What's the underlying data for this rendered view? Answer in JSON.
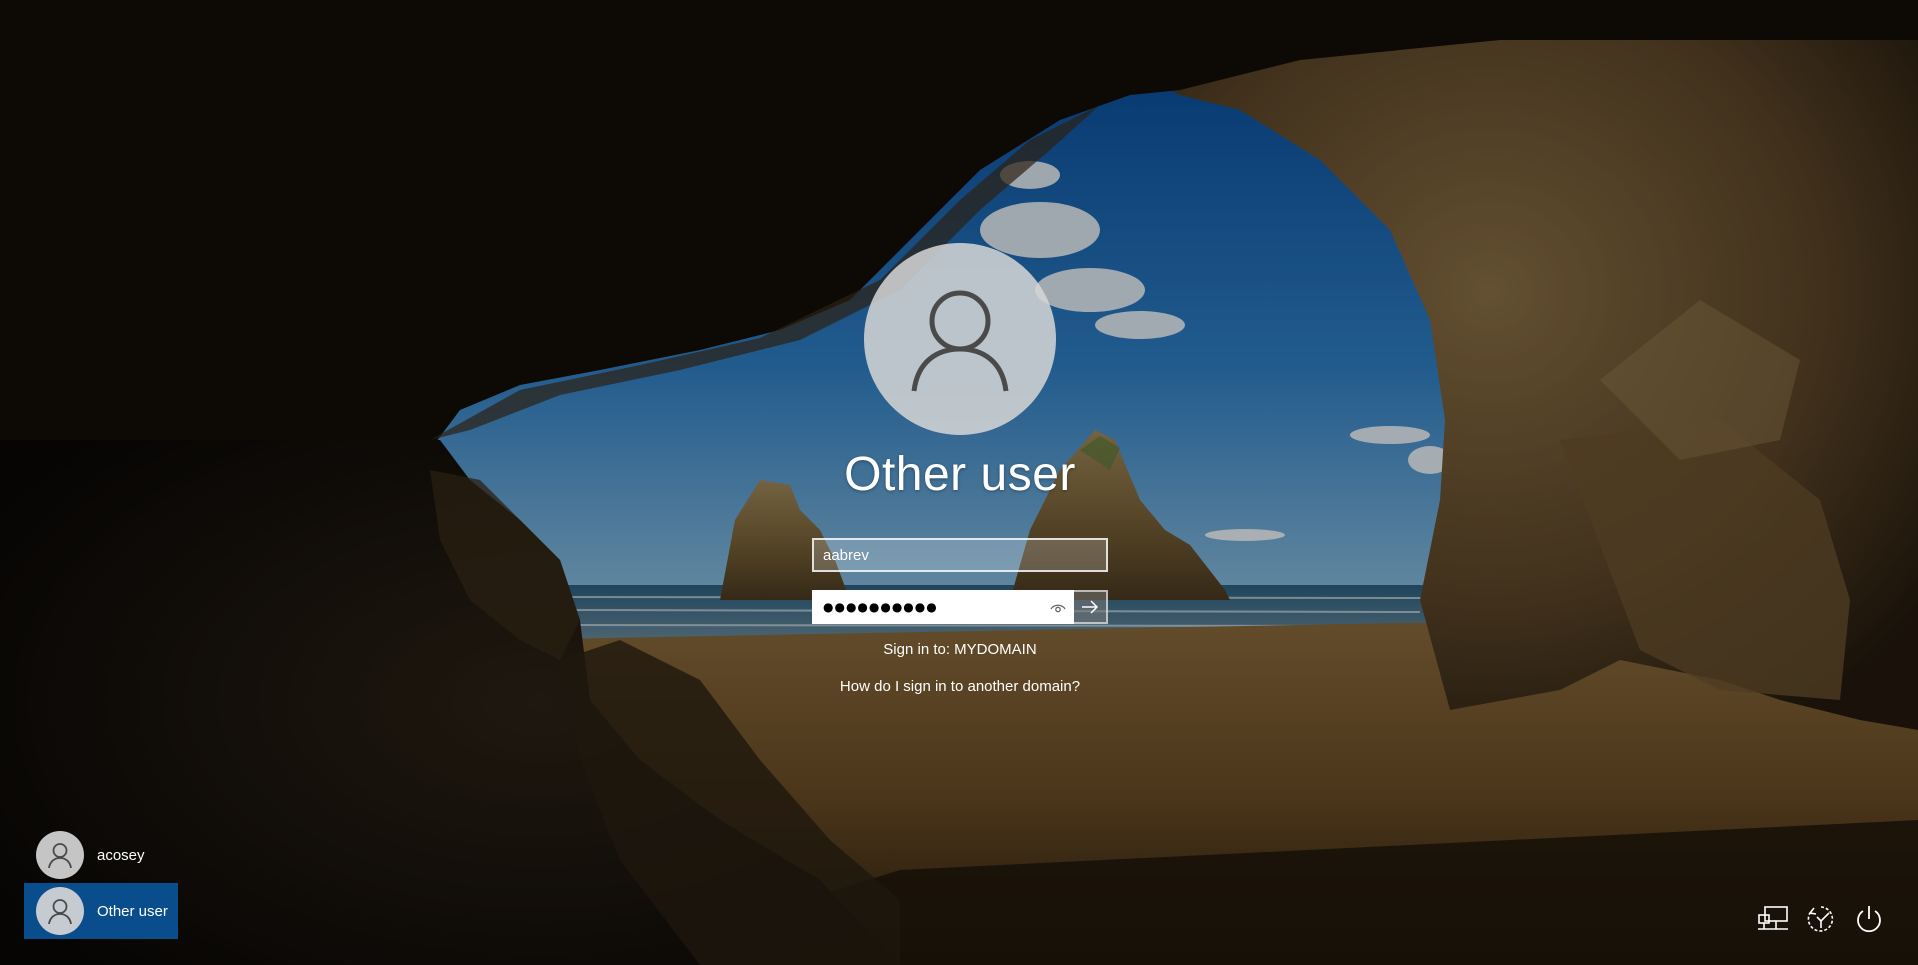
{
  "login": {
    "display_name": "Other user",
    "username_value": "aabrev",
    "password_mask": "●●●●●●●●●●",
    "sign_in_to": "Sign in to: MYDOMAIN",
    "help_link": "How do I sign in to another domain?"
  },
  "user_list": {
    "items": [
      {
        "name": "acosey",
        "selected": false
      },
      {
        "name": "Other user",
        "selected": true
      }
    ]
  },
  "tray": {
    "icons": [
      "network-icon",
      "ease-of-access-icon",
      "power-icon"
    ]
  },
  "colors": {
    "selected_user_bg": "#0a4d8c",
    "avatar_bg": "#d6d6d6",
    "avatar_glyph": "#4a4a4a"
  }
}
